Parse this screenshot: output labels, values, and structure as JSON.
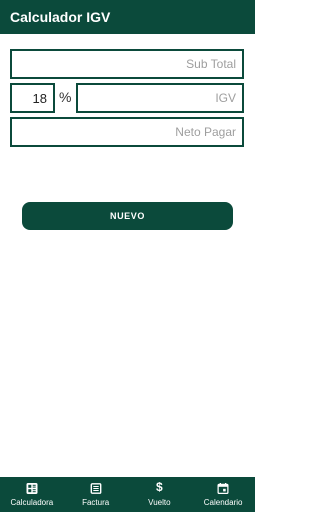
{
  "app": {
    "title": "Calculador IGV"
  },
  "form": {
    "subtotal_placeholder": "Sub Total",
    "percent_value": "18",
    "percent_symbol": "%",
    "igv_placeholder": "IGV",
    "neto_placeholder": "Neto Pagar"
  },
  "actions": {
    "nuevo_label": "NUEVO"
  },
  "bottom_nav": {
    "items": [
      {
        "label": "Calculadora",
        "icon": "calculator-icon"
      },
      {
        "label": "Factura",
        "icon": "receipt-icon"
      },
      {
        "label": "Vuelto",
        "icon": "dollar-icon"
      },
      {
        "label": "Calendario",
        "icon": "calendar-icon"
      }
    ]
  },
  "colors": {
    "primary": "#0b4a3b",
    "background": "#ffffff",
    "placeholder": "#9e9e9e"
  }
}
